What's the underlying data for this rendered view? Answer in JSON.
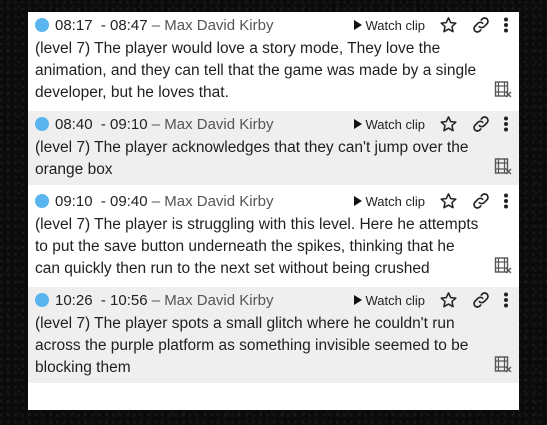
{
  "watch_label": "Watch clip",
  "accent_color": "#5ab4ee",
  "icons": {
    "dot": "circle-dot-icon",
    "play": "play-icon",
    "star": "star-outline-icon",
    "link": "link-icon",
    "more": "vertical-ellipsis-icon",
    "film": "film-clip-icon"
  },
  "annotations": [
    {
      "time": "08:17  - 08:47",
      "author": " – Max David Kirby",
      "text": "(level 7) The player would love a story mode, They love the animation, and they can tell that the game was made by a single developer, but he loves that."
    },
    {
      "time": "08:40  - 09:10",
      "author": " – Max David Kirby",
      "text": "(level 7) The player acknowledges that they can't jump over the orange box"
    },
    {
      "time": "09:10  - 09:40",
      "author": " – Max David Kirby",
      "text": "(level 7) The player is struggling with this level. Here he attempts to put the save button underneath the spikes, thinking that he can quickly then run to the next set without being crushed"
    },
    {
      "time": "10:26  - 10:56",
      "author": " – Max David Kirby",
      "text": "(level 7) The player spots a small glitch where he couldn't run across the purple platform as something invisible seemed to be blocking them"
    }
  ]
}
